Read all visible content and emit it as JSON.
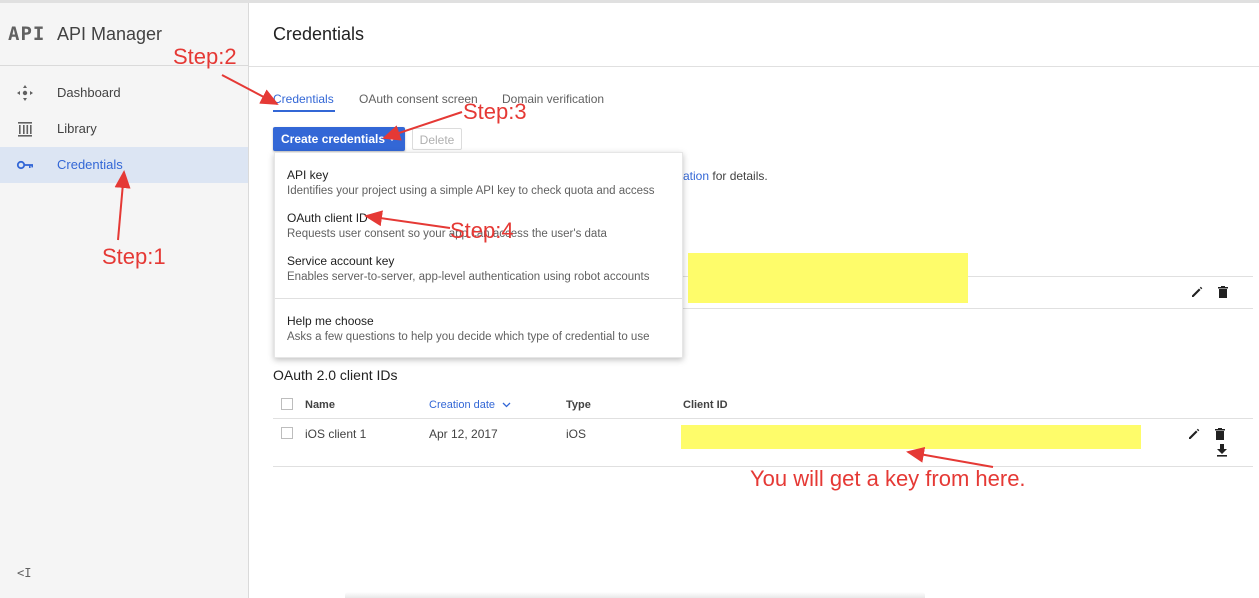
{
  "app": {
    "logo_text": "API",
    "title": "API Manager"
  },
  "sidebar": {
    "items": [
      {
        "label": "Dashboard",
        "icon": "dashboard-icon"
      },
      {
        "label": "Library",
        "icon": "library-icon"
      },
      {
        "label": "Credentials",
        "icon": "key-icon",
        "active": true
      }
    ],
    "collapse_label": "<I"
  },
  "header": {
    "title": "Credentials"
  },
  "tabs": [
    {
      "label": "Credentials",
      "active": true
    },
    {
      "label": "OAuth consent screen"
    },
    {
      "label": "Domain verification"
    }
  ],
  "toolbar": {
    "create_label": "Create credentials",
    "delete_label": "Delete"
  },
  "behind_text": {
    "link": "ation",
    "rest": " for details."
  },
  "menu": {
    "items": [
      {
        "title": "API key",
        "desc": "Identifies your project using a simple API key to check quota and access"
      },
      {
        "title": "OAuth client ID",
        "desc": "Requests user consent so your app can access the user's data"
      },
      {
        "title": "Service account key",
        "desc": "Enables server-to-server, app-level authentication using robot accounts"
      },
      {
        "title": "Help me choose",
        "desc": "Asks a few questions to help you decide which type of credential to use"
      }
    ]
  },
  "oauth": {
    "section_title": "OAuth 2.0 client IDs",
    "columns": [
      "Name",
      "Creation date",
      "Type",
      "Client ID"
    ],
    "rows": [
      {
        "name": "iOS client 1",
        "date": "Apr 12, 2017",
        "type": "iOS"
      }
    ]
  },
  "annotations": {
    "step1": "Step:1",
    "step2": "Step:2",
    "step3": "Step:3",
    "step4": "Step:4",
    "key_note": "You will get a key from here."
  },
  "colors": {
    "accent": "#3367d6",
    "annotation": "#e53935",
    "highlight": "#fefc6a"
  }
}
